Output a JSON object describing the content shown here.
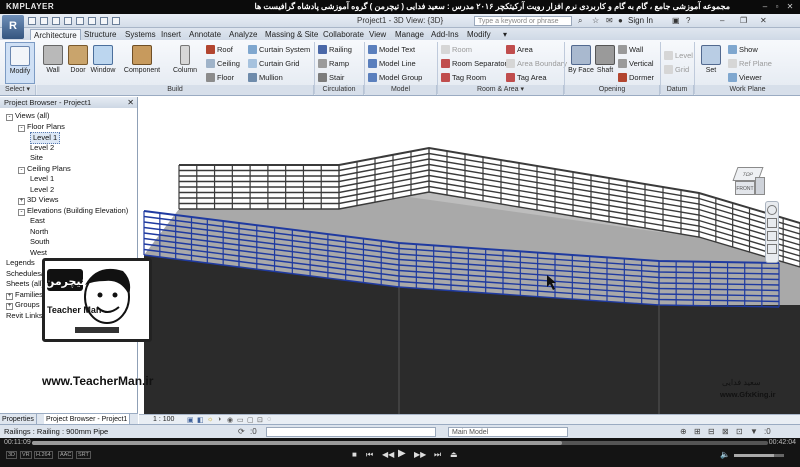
{
  "player": {
    "logo": "KMPLAYER",
    "title": "مجموعه آموزشی جامع ، گام به گام و کاربردی نرم افزار رویت آرکیتکچر ۲۰۱۶   مدرس : سعید فدایی ( تیچرمن ) گروه آموزشی پادشاه گرافیست ها",
    "time_elapsed": "00:11:09",
    "time_total": "00:42:04",
    "progress": 0.72,
    "badges": [
      "3D",
      "VR",
      "H.264",
      "AAC",
      "SRT"
    ]
  },
  "revit": {
    "app_button": "R",
    "doc_title": "Project1 - 3D View: {3D}",
    "search_placeholder": "Type a keyword or phrase",
    "sign_in": "Sign In",
    "tabs": [
      "Architecture",
      "Structure",
      "Systems",
      "Insert",
      "Annotate",
      "Analyze",
      "Massing & Site",
      "Collaborate",
      "View",
      "Manage",
      "Add-Ins",
      "Modify"
    ],
    "active_tab": "Architecture",
    "panels": {
      "select": "Select",
      "build": "Build",
      "circulation": "Circulation",
      "model": "Model",
      "room_area": "Room & Area",
      "opening": "Opening",
      "datum": "Datum",
      "work_plane": "Work Plane"
    },
    "buttons": {
      "modify": "Modify",
      "wall": "Wall",
      "door": "Door",
      "window": "Window",
      "component": "Component",
      "column": "Column",
      "roof": "Roof",
      "ceiling": "Ceiling",
      "floor": "Floor",
      "curtain_system": "Curtain System",
      "curtain_grid": "Curtain Grid",
      "mullion": "Mullion",
      "railing": "Railing",
      "ramp": "Ramp",
      "stair": "Stair",
      "model_text": "Model Text",
      "model_line": "Model Line",
      "model_group": "Model Group",
      "room": "Room",
      "room_separator": "Room Separator",
      "tag_room": "Tag Room",
      "area": "Area",
      "area_boundary": "Area Boundary",
      "tag_area": "Tag Area",
      "by_face": "By Face",
      "shaft": "Shaft",
      "wall_opening": "Wall",
      "vertical": "Vertical",
      "dormer": "Dormer",
      "level": "Level",
      "grid": "Grid",
      "set": "Set",
      "show": "Show",
      "ref_plane": "Ref Plane",
      "viewer": "Viewer"
    },
    "browser": {
      "title": "Project Browser - Project1",
      "items": [
        {
          "label": "Views (all)",
          "level": 0,
          "exp": "-"
        },
        {
          "label": "Floor Plans",
          "level": 1,
          "exp": "-"
        },
        {
          "label": "Level 1",
          "level": 2,
          "exp": "",
          "selected": true
        },
        {
          "label": "Level 2",
          "level": 2,
          "exp": ""
        },
        {
          "label": "Site",
          "level": 2,
          "exp": ""
        },
        {
          "label": "Ceiling Plans",
          "level": 1,
          "exp": "-"
        },
        {
          "label": "Level 1",
          "level": 2,
          "exp": ""
        },
        {
          "label": "Level 2",
          "level": 2,
          "exp": ""
        },
        {
          "label": "3D Views",
          "level": 1,
          "exp": "+"
        },
        {
          "label": "Elevations (Building Elevation)",
          "level": 1,
          "exp": "-"
        },
        {
          "label": "East",
          "level": 2,
          "exp": ""
        },
        {
          "label": "North",
          "level": 2,
          "exp": ""
        },
        {
          "label": "South",
          "level": 2,
          "exp": ""
        },
        {
          "label": "West",
          "level": 2,
          "exp": ""
        },
        {
          "label": "Legends",
          "level": 0,
          "exp": ""
        },
        {
          "label": "Schedules/Quantities",
          "level": 0,
          "exp": ""
        },
        {
          "label": "Sheets (all)",
          "level": 0,
          "exp": ""
        },
        {
          "label": "Families",
          "level": 0,
          "exp": "+"
        },
        {
          "label": "Groups",
          "level": 0,
          "exp": "+"
        },
        {
          "label": "Revit Links",
          "level": 0,
          "exp": ""
        }
      ],
      "tab_properties": "Properties",
      "tab_browser": "Project Browser - Project1"
    },
    "view": {
      "scale": "1 : 100",
      "viewcube_top": "TOP",
      "viewcube_front": "FRONT"
    },
    "status": {
      "text": "Railings : Railing : 900mm Pipe",
      "workset": "Main Model"
    }
  },
  "watermark": {
    "url": "www.TeacherMan.ir",
    "brand": "Teacher Man",
    "brand_fa": "تیچرمن",
    "name_fa": "سعید فدایی",
    "gfx": "www.GfxKing.ir"
  },
  "colors": {
    "railing_blue": "#1f3aa0",
    "railing_gray": "#3a3a3a",
    "floor_top": "#a9a9a9",
    "floor_side": "#2b2b2b",
    "ribbon_bg": "#e3e9f1",
    "player_bg": "#141414"
  }
}
